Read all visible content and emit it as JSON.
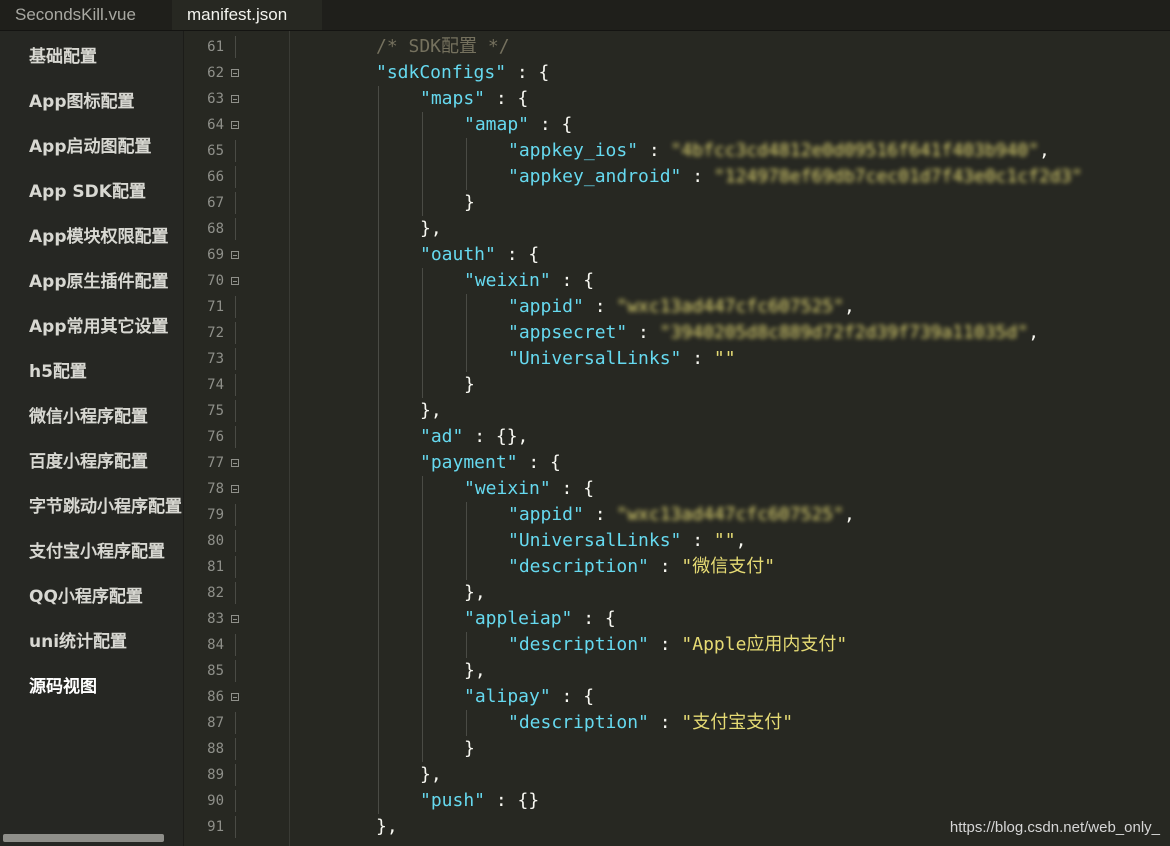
{
  "tabs": [
    {
      "label": "SecondsKill.vue",
      "active": false
    },
    {
      "label": "manifest.json",
      "active": true
    }
  ],
  "sidebar": {
    "items": [
      {
        "label": "基础配置",
        "active": false
      },
      {
        "label": "App图标配置",
        "active": false
      },
      {
        "label": "App启动图配置",
        "active": false
      },
      {
        "label": "App SDK配置",
        "active": false
      },
      {
        "label": "App模块权限配置",
        "active": false
      },
      {
        "label": "App原生插件配置",
        "active": false
      },
      {
        "label": "App常用其它设置",
        "active": false
      },
      {
        "label": "h5配置",
        "active": false
      },
      {
        "label": "微信小程序配置",
        "active": false
      },
      {
        "label": "百度小程序配置",
        "active": false
      },
      {
        "label": "字节跳动小程序配置",
        "active": false
      },
      {
        "label": "支付宝小程序配置",
        "active": false
      },
      {
        "label": "QQ小程序配置",
        "active": false
      },
      {
        "label": "uni统计配置",
        "active": false
      },
      {
        "label": "源码视图",
        "active": true
      }
    ]
  },
  "editor": {
    "lines": [
      {
        "num": "61",
        "indent": 0,
        "fold": false,
        "tokens": [
          {
            "t": "/* SDK配置 */",
            "c": "c"
          }
        ]
      },
      {
        "num": "62",
        "indent": 0,
        "fold": true,
        "tokens": [
          {
            "t": "\"sdkConfigs\"",
            "c": "k"
          },
          {
            "t": " : {",
            "c": "p"
          }
        ]
      },
      {
        "num": "63",
        "indent": 1,
        "fold": true,
        "tokens": [
          {
            "t": "\"maps\"",
            "c": "k"
          },
          {
            "t": " : {",
            "c": "p"
          }
        ]
      },
      {
        "num": "64",
        "indent": 2,
        "fold": true,
        "tokens": [
          {
            "t": "\"amap\"",
            "c": "k"
          },
          {
            "t": " : {",
            "c": "p"
          }
        ]
      },
      {
        "num": "65",
        "indent": 3,
        "fold": false,
        "tokens": [
          {
            "t": "\"appkey_ios\"",
            "c": "k"
          },
          {
            "t": " : ",
            "c": "p"
          },
          {
            "t": "\"4bfcc3cd4812e0d09516f641f403b940\"",
            "c": "s",
            "blur": true
          },
          {
            "t": ",",
            "c": "p"
          }
        ]
      },
      {
        "num": "66",
        "indent": 3,
        "fold": false,
        "tokens": [
          {
            "t": "\"appkey_android\"",
            "c": "k"
          },
          {
            "t": " : ",
            "c": "p"
          },
          {
            "t": "\"124978ef69db7cec01d7f43e0c1cf2d3\"",
            "c": "s",
            "blur": true
          }
        ]
      },
      {
        "num": "67",
        "indent": 2,
        "fold": false,
        "tokens": [
          {
            "t": "}",
            "c": "p"
          }
        ]
      },
      {
        "num": "68",
        "indent": 1,
        "fold": false,
        "tokens": [
          {
            "t": "},",
            "c": "p"
          }
        ]
      },
      {
        "num": "69",
        "indent": 1,
        "fold": true,
        "tokens": [
          {
            "t": "\"oauth\"",
            "c": "k"
          },
          {
            "t": " : {",
            "c": "p"
          }
        ]
      },
      {
        "num": "70",
        "indent": 2,
        "fold": true,
        "tokens": [
          {
            "t": "\"weixin\"",
            "c": "k"
          },
          {
            "t": " : {",
            "c": "p"
          }
        ]
      },
      {
        "num": "71",
        "indent": 3,
        "fold": false,
        "tokens": [
          {
            "t": "\"appid\"",
            "c": "k"
          },
          {
            "t": " : ",
            "c": "p"
          },
          {
            "t": "\"wxc13ad447cfc607525\"",
            "c": "s",
            "blur": true
          },
          {
            "t": ",",
            "c": "p"
          }
        ]
      },
      {
        "num": "72",
        "indent": 3,
        "fold": false,
        "tokens": [
          {
            "t": "\"appsecret\"",
            "c": "k"
          },
          {
            "t": " : ",
            "c": "p"
          },
          {
            "t": "\"3940205d8c889d72f2d39f739a11035d\"",
            "c": "s",
            "blur": true
          },
          {
            "t": ",",
            "c": "p"
          }
        ]
      },
      {
        "num": "73",
        "indent": 3,
        "fold": false,
        "tokens": [
          {
            "t": "\"UniversalLinks\"",
            "c": "k"
          },
          {
            "t": " : ",
            "c": "p"
          },
          {
            "t": "\"\"",
            "c": "s"
          }
        ]
      },
      {
        "num": "74",
        "indent": 2,
        "fold": false,
        "tokens": [
          {
            "t": "}",
            "c": "p"
          }
        ]
      },
      {
        "num": "75",
        "indent": 1,
        "fold": false,
        "tokens": [
          {
            "t": "},",
            "c": "p"
          }
        ]
      },
      {
        "num": "76",
        "indent": 1,
        "fold": false,
        "tokens": [
          {
            "t": "\"ad\"",
            "c": "k"
          },
          {
            "t": " : {},",
            "c": "p"
          }
        ]
      },
      {
        "num": "77",
        "indent": 1,
        "fold": true,
        "tokens": [
          {
            "t": "\"payment\"",
            "c": "k"
          },
          {
            "t": " : {",
            "c": "p"
          }
        ]
      },
      {
        "num": "78",
        "indent": 2,
        "fold": true,
        "tokens": [
          {
            "t": "\"weixin\"",
            "c": "k"
          },
          {
            "t": " : {",
            "c": "p"
          }
        ]
      },
      {
        "num": "79",
        "indent": 3,
        "fold": false,
        "tokens": [
          {
            "t": "\"appid\"",
            "c": "k"
          },
          {
            "t": " : ",
            "c": "p"
          },
          {
            "t": "\"wxc13ad447cfc607525\"",
            "c": "s",
            "blur": true
          },
          {
            "t": ",",
            "c": "p"
          }
        ]
      },
      {
        "num": "80",
        "indent": 3,
        "fold": false,
        "tokens": [
          {
            "t": "\"UniversalLinks\"",
            "c": "k"
          },
          {
            "t": " : ",
            "c": "p"
          },
          {
            "t": "\"\"",
            "c": "s"
          },
          {
            "t": ",",
            "c": "p"
          }
        ]
      },
      {
        "num": "81",
        "indent": 3,
        "fold": false,
        "tokens": [
          {
            "t": "\"description\"",
            "c": "k"
          },
          {
            "t": " : ",
            "c": "p"
          },
          {
            "t": "\"微信支付\"",
            "c": "s"
          }
        ]
      },
      {
        "num": "82",
        "indent": 2,
        "fold": false,
        "tokens": [
          {
            "t": "},",
            "c": "p"
          }
        ]
      },
      {
        "num": "83",
        "indent": 2,
        "fold": true,
        "tokens": [
          {
            "t": "\"appleiap\"",
            "c": "k"
          },
          {
            "t": " : {",
            "c": "p"
          }
        ]
      },
      {
        "num": "84",
        "indent": 3,
        "fold": false,
        "tokens": [
          {
            "t": "\"description\"",
            "c": "k"
          },
          {
            "t": " : ",
            "c": "p"
          },
          {
            "t": "\"Apple应用内支付\"",
            "c": "s"
          }
        ]
      },
      {
        "num": "85",
        "indent": 2,
        "fold": false,
        "tokens": [
          {
            "t": "},",
            "c": "p"
          }
        ]
      },
      {
        "num": "86",
        "indent": 2,
        "fold": true,
        "tokens": [
          {
            "t": "\"alipay\"",
            "c": "k"
          },
          {
            "t": " : {",
            "c": "p"
          }
        ]
      },
      {
        "num": "87",
        "indent": 3,
        "fold": false,
        "tokens": [
          {
            "t": "\"description\"",
            "c": "k"
          },
          {
            "t": " : ",
            "c": "p"
          },
          {
            "t": "\"支付宝支付\"",
            "c": "s"
          }
        ]
      },
      {
        "num": "88",
        "indent": 2,
        "fold": false,
        "tokens": [
          {
            "t": "}",
            "c": "p"
          }
        ]
      },
      {
        "num": "89",
        "indent": 1,
        "fold": false,
        "tokens": [
          {
            "t": "},",
            "c": "p"
          }
        ]
      },
      {
        "num": "90",
        "indent": 1,
        "fold": false,
        "tokens": [
          {
            "t": "\"push\"",
            "c": "k"
          },
          {
            "t": " : {}",
            "c": "p"
          }
        ]
      },
      {
        "num": "91",
        "indent": 0,
        "fold": false,
        "tokens": [
          {
            "t": "},",
            "c": "p"
          }
        ]
      }
    ]
  },
  "watermark": "https://blog.csdn.net/web_only_",
  "colors": {
    "background": "#272822",
    "key": "#66d9ef",
    "string": "#e6db74",
    "comment": "#75715e",
    "punctuation": "#f8f8f2",
    "line_number": "#8f908a"
  }
}
